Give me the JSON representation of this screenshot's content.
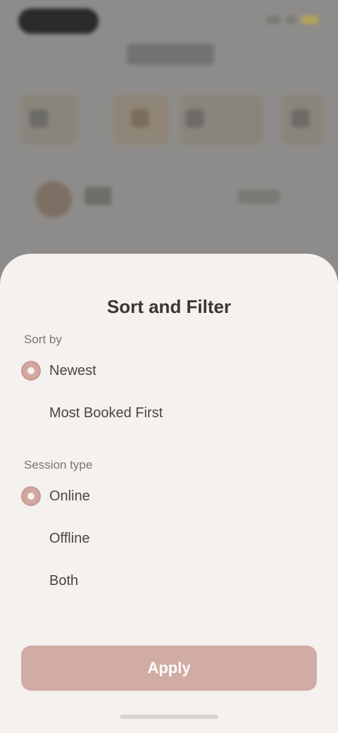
{
  "sheet": {
    "title": "Sort and Filter",
    "sections": [
      {
        "label": "Sort by",
        "options": [
          {
            "label": "Newest",
            "selected": true
          },
          {
            "label": "Most Booked First",
            "selected": false
          }
        ]
      },
      {
        "label": "Session type",
        "options": [
          {
            "label": "Online",
            "selected": true
          },
          {
            "label": "Offline",
            "selected": false
          },
          {
            "label": "Both",
            "selected": false
          }
        ]
      }
    ],
    "apply_label": "Apply"
  },
  "colors": {
    "accent": "#d3a7a0",
    "sheet_background": "#f4f1ee",
    "button_background": "#d0aca4"
  }
}
